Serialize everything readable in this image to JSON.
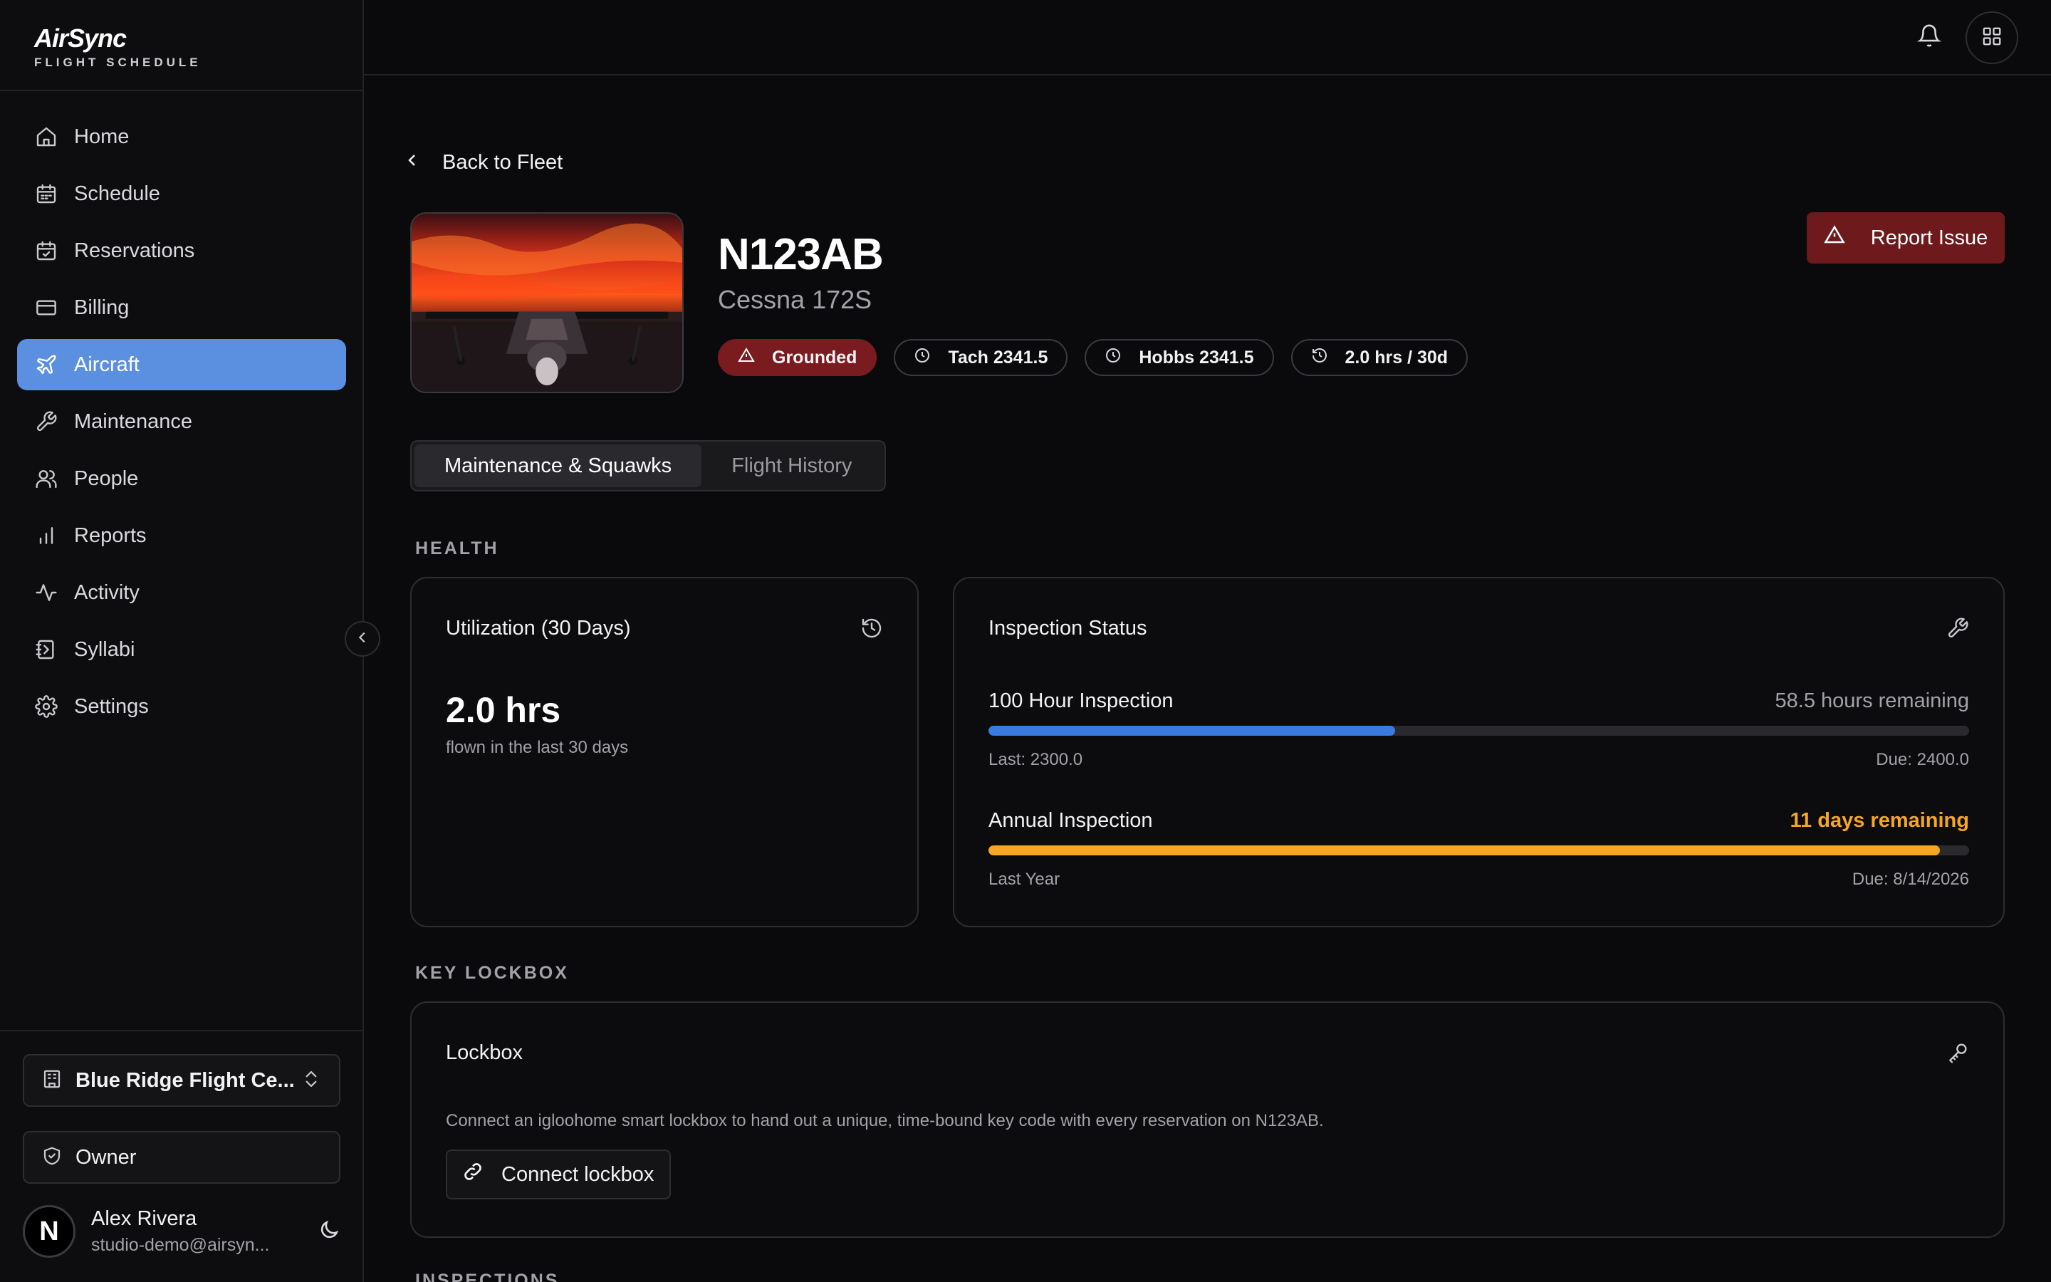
{
  "brand": {
    "logo": "AirSync",
    "subtitle": "FLIGHT SCHEDULE"
  },
  "nav": {
    "items": [
      {
        "label": "Home",
        "icon": "home-icon"
      },
      {
        "label": "Schedule",
        "icon": "calendar-icon"
      },
      {
        "label": "Reservations",
        "icon": "calendar-check-icon"
      },
      {
        "label": "Billing",
        "icon": "credit-card-icon"
      },
      {
        "label": "Aircraft",
        "icon": "plane-icon",
        "active": true
      },
      {
        "label": "Maintenance",
        "icon": "wrench-icon"
      },
      {
        "label": "People",
        "icon": "users-icon"
      },
      {
        "label": "Reports",
        "icon": "bar-chart-icon"
      },
      {
        "label": "Activity",
        "icon": "activity-icon"
      },
      {
        "label": "Syllabi",
        "icon": "notebook-icon"
      },
      {
        "label": "Settings",
        "icon": "gear-icon"
      }
    ]
  },
  "org": {
    "name": "Blue Ridge Flight Ce..."
  },
  "role": {
    "label": "Owner"
  },
  "user": {
    "initial": "N",
    "name": "Alex Rivera",
    "email": "studio-demo@airsyn..."
  },
  "back": {
    "label": "Back to Fleet"
  },
  "aircraft": {
    "tail": "N123AB",
    "model": "Cessna 172S",
    "badges": [
      {
        "label": "Grounded",
        "icon": "alert-triangle-icon",
        "status": "danger"
      },
      {
        "label": "Tach 2341.5",
        "icon": "clock-icon"
      },
      {
        "label": "Hobbs 2341.5",
        "icon": "clock-icon"
      },
      {
        "label": "2.0 hrs / 30d",
        "icon": "history-icon"
      }
    ]
  },
  "actions": {
    "report_issue": "Report Issue"
  },
  "tabs": [
    {
      "label": "Maintenance & Squawks",
      "active": true
    },
    {
      "label": "Flight History",
      "active": false
    }
  ],
  "sections": {
    "health": "HEALTH",
    "lockbox": "KEY LOCKBOX",
    "inspections": "INSPECTIONS"
  },
  "utilization": {
    "title": "Utilization (30 Days)",
    "value": "2.0 hrs",
    "caption": "flown in the last 30 days"
  },
  "inspection_status": {
    "title": "Inspection Status",
    "items": [
      {
        "name": "100 Hour Inspection",
        "remaining": "58.5 hours remaining",
        "progress": 0.415,
        "color": "#3b7ae0",
        "last": "Last: 2300.0",
        "due": "Due: 2400.0",
        "warn": false
      },
      {
        "name": "Annual Inspection",
        "remaining": "11 days remaining",
        "progress": 0.97,
        "color": "#f5a623",
        "last": "Last Year",
        "due": "Due: 8/14/2026",
        "warn": true
      }
    ]
  },
  "lockbox": {
    "title": "Lockbox",
    "description": "Connect an igloohome smart lockbox to hand out a unique, time-bound key code with every reservation on N123AB.",
    "connect_label": "Connect lockbox"
  },
  "colors": {
    "accent": "#5b8fe0",
    "danger": "#7a1b1f",
    "warn": "#f5a623",
    "progress_blue": "#3b7ae0"
  }
}
